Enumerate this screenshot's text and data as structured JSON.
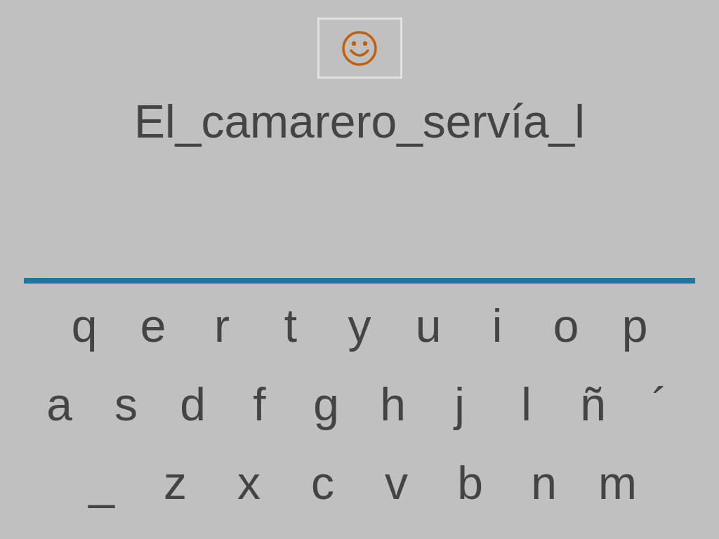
{
  "sentence": "El_camarero_servía_l",
  "keyboard": {
    "rows": [
      [
        "q",
        "e",
        "r",
        "t",
        "y",
        "u",
        "i",
        "o",
        "p"
      ],
      [
        "a",
        "s",
        "d",
        "f",
        "g",
        "h",
        "j",
        "l",
        "ñ",
        "´"
      ],
      [
        "_",
        "z",
        "x",
        "c",
        "v",
        "b",
        "n",
        "m"
      ]
    ]
  }
}
